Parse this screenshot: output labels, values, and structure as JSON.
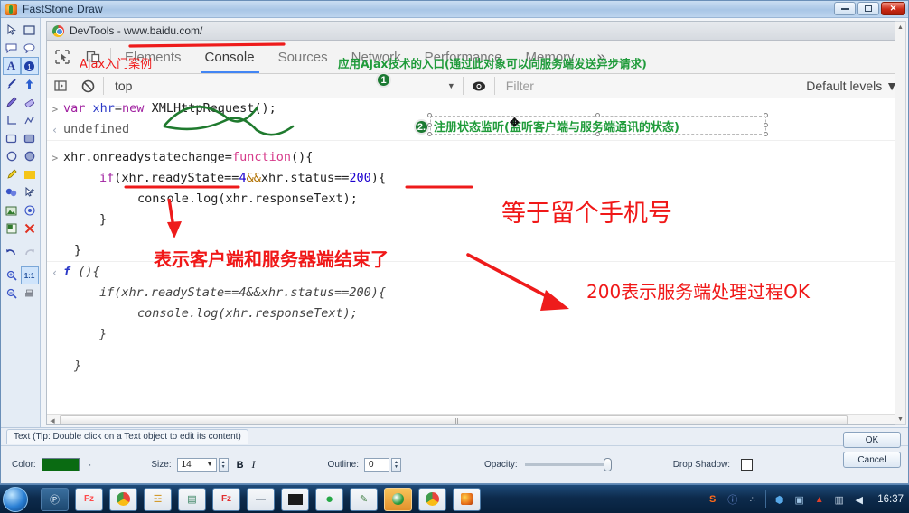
{
  "window": {
    "app_title": "FastStone Draw",
    "app_icon": "faststone-icon",
    "minimize_label": "Minimize",
    "restore_label": "Restore",
    "close_label": "✕"
  },
  "toolrail": {
    "tools": [
      {
        "name": "select-arrow-tool",
        "glyph": "↖",
        "selected": false
      },
      {
        "name": "rectangle-select-tool",
        "glyph": "▭",
        "selected": false
      },
      {
        "name": "callout-left-tool",
        "glyph": "὞8",
        "selected": false
      },
      {
        "name": "callout-round-tool",
        "glyph": "○",
        "selected": false
      },
      {
        "name": "text-tool",
        "glyph": "A",
        "selected": true
      },
      {
        "name": "info-badge-tool",
        "glyph": "①",
        "selected": true
      },
      {
        "name": "magic-wand-tool",
        "glyph": "✒",
        "selected": false
      },
      {
        "name": "arrow-up-tool",
        "glyph": "↑",
        "selected": false
      },
      {
        "name": "pencil-tool",
        "glyph": "✎",
        "selected": false
      },
      {
        "name": "eraser-tool",
        "glyph": "▱",
        "selected": false
      },
      {
        "name": "corner-line-tool",
        "glyph": "L",
        "selected": false
      },
      {
        "name": "polyline-tool",
        "glyph": "⤳",
        "selected": false
      },
      {
        "name": "rect-shape-tool",
        "glyph": "□",
        "selected": false
      },
      {
        "name": "rect-filled-tool",
        "glyph": "▣",
        "selected": false
      },
      {
        "name": "ellipse-shape-tool",
        "glyph": "○",
        "selected": false
      },
      {
        "name": "ellipse-filled-tool",
        "glyph": "◉",
        "selected": false
      },
      {
        "name": "highlighter-tool",
        "glyph": "✏",
        "selected": false
      },
      {
        "name": "fill-color-tool",
        "glyph": "■",
        "selected": false
      },
      {
        "name": "blur-tool",
        "glyph": "❦",
        "selected": false
      },
      {
        "name": "clone-tool",
        "glyph": "✣",
        "selected": false
      },
      {
        "name": "image-tool",
        "glyph": "⛰",
        "selected": false
      },
      {
        "name": "spotlight-tool",
        "glyph": "☉",
        "selected": false
      },
      {
        "name": "crop-tool",
        "glyph": "❐",
        "selected": false
      },
      {
        "name": "delete-tool",
        "glyph": "✕",
        "selected": false
      },
      {
        "name": "undo-tool",
        "glyph": "↶",
        "selected": false
      },
      {
        "name": "redo-tool",
        "glyph": "↷",
        "selected": false
      },
      {
        "name": "zoom-in-tool",
        "glyph": "⌕",
        "selected": false
      },
      {
        "name": "zoom-actual-tool",
        "glyph": "1:1",
        "selected": true
      },
      {
        "name": "zoom-out-tool",
        "glyph": "⌕",
        "selected": false
      },
      {
        "name": "print-tool",
        "glyph": "⎙",
        "selected": false
      }
    ]
  },
  "devtools": {
    "tab_title": "DevTools - www.baidu.com/",
    "toolbar": {
      "inspect_icon": "inspect-element-icon",
      "device_icon": "device-toolbar-icon",
      "more_label": "»",
      "tabs": [
        {
          "label": "Elements",
          "active": false
        },
        {
          "label": "Console",
          "active": true
        },
        {
          "label": "Sources",
          "active": false
        },
        {
          "label": "Network",
          "active": false
        },
        {
          "label": "Performance",
          "active": false
        },
        {
          "label": "Memory",
          "active": false
        }
      ]
    },
    "filterbar": {
      "sidebar_icon": "console-sidebar-icon",
      "clear_icon": "clear-console-icon",
      "context_value": "top",
      "caret": "▼",
      "eye_icon": "live-expression-icon",
      "filter_placeholder": "Filter",
      "levels_label": "Default levels",
      "levels_caret": "▼"
    },
    "console": {
      "entries": [
        {
          "type": "input",
          "marker": ">",
          "segments": [
            {
              "t": "var ",
              "c": "kw"
            },
            {
              "t": "xhr",
              "c": "var"
            },
            {
              "t": "=",
              "c": "plain"
            },
            {
              "t": "new ",
              "c": "kw"
            },
            {
              "t": "XMLHttpRequest();",
              "c": "plain"
            }
          ]
        },
        {
          "type": "output",
          "marker": "‹",
          "text": "undefined"
        },
        {
          "type": "input",
          "marker": ">",
          "segments": [
            {
              "t": "xhr.onreadystatechange=",
              "c": "plain"
            },
            {
              "t": "function",
              "c": "fn"
            },
            {
              "t": "(){",
              "c": "plain"
            }
          ]
        },
        {
          "type": "input-cont",
          "indent": 1,
          "segments": [
            {
              "t": "if",
              "c": "kw"
            },
            {
              "t": "(xhr.readyState==",
              "c": "plain"
            },
            {
              "t": "4",
              "c": "num"
            },
            {
              "t": "&&",
              "c": "op"
            },
            {
              "t": "xhr.status==",
              "c": "plain"
            },
            {
              "t": "200",
              "c": "num"
            },
            {
              "t": "){",
              "c": "plain"
            }
          ]
        },
        {
          "type": "input-cont",
          "indent": 2,
          "segments": [
            {
              "t": "console.log(xhr.responseText);",
              "c": "plain"
            }
          ]
        },
        {
          "type": "input-cont",
          "indent": 1,
          "segments": [
            {
              "t": "}",
              "c": "plain"
            }
          ]
        },
        {
          "type": "input-cont",
          "indent": 0,
          "segments": [
            {
              "t": "}",
              "c": "plain"
            }
          ]
        },
        {
          "type": "output-fn",
          "marker": "‹",
          "fn_label": "f",
          "text": " (){"
        },
        {
          "type": "output-cont",
          "indent": 1,
          "text": "if(xhr.readyState==4&&xhr.status==200){"
        },
        {
          "type": "output-cont",
          "indent": 2,
          "text": "console.log(xhr.responseText);"
        },
        {
          "type": "output-cont",
          "indent": 1,
          "text": "}"
        },
        {
          "type": "output-cont",
          "indent": 0,
          "text": "}"
        }
      ]
    }
  },
  "annotations": {
    "red_url_underline": "red-underline-over-url",
    "ajax_label": "Ajax入门案例",
    "green_entry_note": "应用Ajax技术的入口(通过此对象可以向服务端发送异步请求)",
    "badge_one": "1",
    "badge_two": "2.",
    "green_state_note": "注册状态监听(监听客户端与服务端通讯的状态)",
    "red_note_client_end": "表示客户端和服务器端结束了",
    "red_note_phone": "等于留个手机号",
    "red_note_200": "200表示服务端处理过程OK",
    "colors": {
      "red": "#f01818",
      "green": "#1f9b3a",
      "dark_green": "#0a6b12",
      "accent_blue": "#4285f4"
    }
  },
  "properties": {
    "tab_label": "Text (Tip: Double click on a Text object to edit its content)",
    "color_label": "Color:",
    "color_value": "#0a6b12",
    "color_more": "·",
    "size_label": "Size:",
    "size_value": "14",
    "bold_label": "B",
    "italic_label": "I",
    "outline_label": "Outline:",
    "outline_value": "0",
    "opacity_label": "Opacity:",
    "drop_shadow_label": "Drop Shadow:",
    "ok_label": "OK",
    "cancel_label": "Cancel"
  },
  "taskbar": {
    "start_label": "start-orb",
    "items": [
      {
        "name": "taskbar-item-pdf",
        "glyph": "Ⓟ",
        "hot": false
      },
      {
        "name": "taskbar-item-flashfxp",
        "glyph": "Fz",
        "hot": false
      },
      {
        "name": "taskbar-item-chrome-1",
        "glyph": "●",
        "hot": false
      },
      {
        "name": "taskbar-item-explorer",
        "glyph": "☲",
        "hot": false
      },
      {
        "name": "taskbar-item-notepad",
        "glyph": "▤",
        "hot": false
      },
      {
        "name": "taskbar-item-flashfxp-2",
        "glyph": "Fz",
        "hot": false
      },
      {
        "name": "taskbar-item-minimized",
        "glyph": "—",
        "hot": false
      },
      {
        "name": "taskbar-item-terminal",
        "glyph": "▄",
        "hot": false
      },
      {
        "name": "taskbar-item-green-app",
        "glyph": "●",
        "hot": false
      },
      {
        "name": "taskbar-item-editor",
        "glyph": "✎",
        "hot": false
      },
      {
        "name": "taskbar-item-faststone",
        "glyph": "◔",
        "hot": true
      },
      {
        "name": "taskbar-item-chrome-2",
        "glyph": "●",
        "hot": false
      },
      {
        "name": "taskbar-item-faststone-draw",
        "glyph": "▲",
        "hot": false
      }
    ],
    "tray": [
      {
        "name": "tray-sogou-icon",
        "glyph": "S"
      },
      {
        "name": "tray-input-icon",
        "glyph": "ⓘ"
      },
      {
        "name": "tray-overflow-icon",
        "glyph": "∴"
      },
      {
        "name": "tray-security-icon",
        "glyph": "⬢"
      },
      {
        "name": "tray-network-icon",
        "glyph": "▣"
      },
      {
        "name": "tray-graphics-icon",
        "glyph": "▲"
      },
      {
        "name": "tray-save-icon",
        "glyph": "▥"
      },
      {
        "name": "tray-volume-icon",
        "glyph": "◀"
      }
    ],
    "clock": "16:37"
  }
}
